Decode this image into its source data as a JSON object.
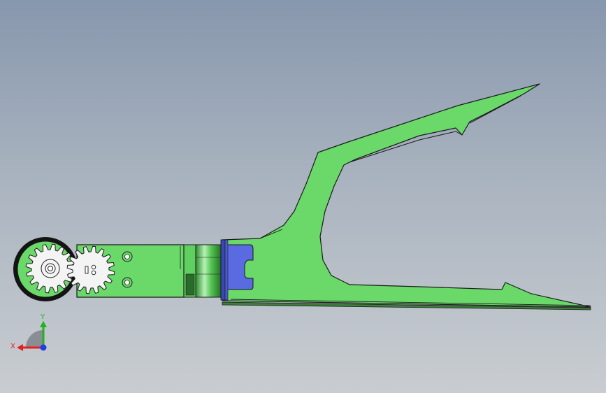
{
  "colors": {
    "part_green": "#6ad96a",
    "part_outline": "#1a1a1a",
    "hinge_green": "#4fb84f",
    "clamp_blue": "#5a6ae0",
    "tire_black": "#141414",
    "gear_white": "#f4f4f4",
    "axis_x": "#e32121",
    "axis_y": "#1fb31f",
    "axis_z": "#1f3fe3"
  },
  "triad": {
    "x_label": "X",
    "y_label": "Y"
  }
}
